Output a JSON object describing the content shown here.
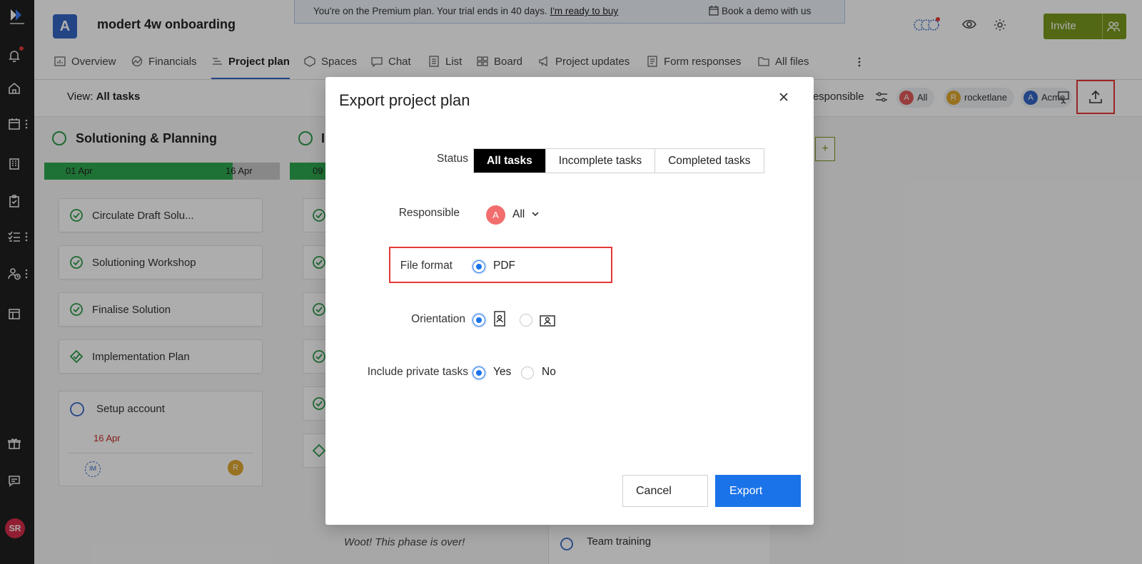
{
  "project": {
    "badge": "A",
    "title": "modert 4w onboarding"
  },
  "banner": {
    "text": "You're on the Premium plan. Your trial ends in 40 days.",
    "link": "I'm ready to buy",
    "demo": "Book a demo with us"
  },
  "header": {
    "invite_label": "Invite"
  },
  "tabs": [
    {
      "label": "Overview",
      "icon": "overview-icon"
    },
    {
      "label": "Financials",
      "icon": "financials-icon"
    },
    {
      "label": "Project plan",
      "icon": "project-plan-icon",
      "active": true
    },
    {
      "label": "Spaces",
      "icon": "spaces-icon"
    },
    {
      "label": "Chat",
      "icon": "chat-icon"
    },
    {
      "label": "List",
      "icon": "list-icon"
    },
    {
      "label": "Board",
      "icon": "board-icon"
    },
    {
      "label": "Project updates",
      "icon": "megaphone-icon"
    },
    {
      "label": "Form responses",
      "icon": "form-icon"
    },
    {
      "label": "All files",
      "icon": "folder-icon"
    }
  ],
  "toolbar": {
    "view_prefix": "View:",
    "view_value": "All tasks",
    "responsible_label": "Responsible",
    "chips": [
      {
        "initial": "A",
        "label": "All",
        "color": "#e05a5a"
      },
      {
        "initial": "R",
        "label": "rocketlane",
        "color": "#e0a830"
      },
      {
        "initial": "A",
        "label": "Acme",
        "color": "#3466c6"
      }
    ]
  },
  "board": {
    "phase1": {
      "title": "Solutioning & Planning",
      "start": "01 Apr",
      "end": "16 Apr"
    },
    "phase2": {
      "title": "I",
      "start": "09"
    },
    "cards": [
      "Circulate Draft Solu...",
      "Solutioning Workshop",
      "Finalise Solution",
      "Implementation Plan"
    ],
    "setup": {
      "name": "Setup account",
      "date": "16 Apr",
      "assignee_badge": "IM",
      "owner_initial": "R"
    },
    "woot": "Woot! This phase is over!",
    "team_training": "Team training",
    "add_symbol": "+"
  },
  "rail": {
    "user_initials": "SR"
  },
  "modal": {
    "title": "Export project plan",
    "status_label": "Status",
    "status_options": [
      "All tasks",
      "Incomplete tasks",
      "Completed tasks"
    ],
    "status_selected": "All tasks",
    "responsible_label": "Responsible",
    "responsible_initial": "A",
    "responsible_value": "All",
    "file_format_label": "File format",
    "file_format_value": "PDF",
    "orientation_label": "Orientation",
    "orientation_selected": "portrait",
    "private_label": "Include private tasks",
    "private_yes": "Yes",
    "private_no": "No",
    "private_selected": "Yes",
    "cancel_label": "Cancel",
    "export_label": "Export"
  },
  "colors": {
    "accent": "#1a73e8",
    "brand_green": "#7a9a1e",
    "highlight_red": "#e53935",
    "gantt_green": "#2fa84f"
  }
}
